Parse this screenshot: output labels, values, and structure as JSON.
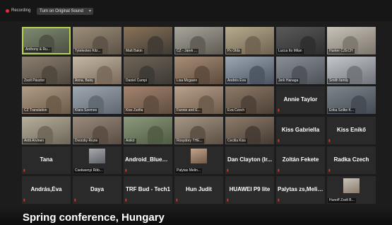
{
  "topbar": {
    "recording_label": "Recording",
    "sound_button_label": "Turn on Original Sound"
  },
  "caption": "Spring conference, Hungary",
  "tiles": [
    {
      "name": "Anthony & Ru...",
      "active": true,
      "video": true,
      "c1": "#7d8a70",
      "c2": "#4b4f43"
    },
    {
      "name": "Tyteleoteo Kilz...",
      "video": true,
      "c1": "#9c8e7a",
      "c2": "#5b5145"
    },
    {
      "name": "Matt Bakin",
      "video": true,
      "c1": "#8a7359",
      "c2": "#3e3a34"
    },
    {
      "name": "CZ - Jarek ...",
      "video": true,
      "c1": "#a7a69d",
      "c2": "#5f5a52"
    },
    {
      "name": "Px Olda",
      "video": true,
      "c1": "#b7ab8e",
      "c2": "#6e6251"
    },
    {
      "name": "Lucca Ito Milan",
      "video": true,
      "c1": "#5a5a5a",
      "c2": "#2e2e2e"
    },
    {
      "name": "Hunter CZECH",
      "video": true,
      "c1": "#c7c3bb",
      "c2": "#7d756b"
    },
    {
      "name": "Zsolt Pásztor",
      "video": true,
      "c1": "#8b7f70",
      "c2": "#4d463c"
    },
    {
      "name": "Anna, Baloj",
      "video": true,
      "c1": "#c3b8a4",
      "c2": "#78685a"
    },
    {
      "name": "Daniel Campi",
      "video": true,
      "c1": "#6f6658",
      "c2": "#3c3834"
    },
    {
      "name": "Lisa Mcgavin",
      "video": true,
      "c1": "#a88f78",
      "c2": "#5c4a3c"
    },
    {
      "name": "Andrés Eva",
      "video": true,
      "c1": "#9da6b2",
      "c2": "#4b5361"
    },
    {
      "name": "Jerk Hanaga",
      "video": true,
      "c1": "#8a8f96",
      "c2": "#4d5057"
    },
    {
      "name": "Smith family",
      "video": true,
      "c1": "#c4c7cc",
      "c2": "#6f7278"
    },
    {
      "name": "CZ Translation",
      "video": true,
      "c1": "#b19d87",
      "c2": "#6a5a48"
    },
    {
      "name": "Klara Szemes",
      "video": true,
      "c1": "#9fa7b0",
      "c2": "#5e6670"
    },
    {
      "name": "Kiss Zsófia",
      "video": true,
      "c1": "#a58470",
      "c2": "#5e4c3e"
    },
    {
      "name": "Fannie and E...",
      "video": true,
      "c1": "#b9a28d",
      "c2": "#6c5a4a"
    },
    {
      "name": "Eva Czech",
      "video": true,
      "c1": "#8e7a68",
      "c2": "#4c4036"
    },
    {
      "name": "Annie Taylor",
      "video": false
    },
    {
      "name": "Erika Szilke K...",
      "video": true,
      "c1": "#7e858d",
      "c2": "#444a52"
    },
    {
      "name": "Antti Arvinen",
      "video": true,
      "c1": "#b8b09e",
      "c2": "#6d6556"
    },
    {
      "name": "Dvorzky Rozie",
      "video": true,
      "c1": "#9a8b7c",
      "c2": "#584c42"
    },
    {
      "name": "Anikó",
      "video": true,
      "c1": "#8d9a7c",
      "c2": "#4f5a42"
    },
    {
      "name": "Rosydory THE...",
      "video": true,
      "c1": "#a69886",
      "c2": "#5b4f43"
    },
    {
      "name": "Cecilia Kiss",
      "video": true,
      "c1": "#8f7d6c",
      "c2": "#443a32"
    },
    {
      "name": "Kiss Gabriella",
      "video": false
    },
    {
      "name": "Kiss Enikő",
      "video": false
    },
    {
      "name": "Tana",
      "video": false
    },
    {
      "name": "Csekwenyi Rób...",
      "video": false,
      "thumb": true,
      "c1": "#a7a9ad",
      "c2": "#5e6167"
    },
    {
      "name": "Android_Bluedr...",
      "video": false
    },
    {
      "name": "Palytas Melin...",
      "video": false,
      "thumb": true,
      "c1": "#c2a48c",
      "c2": "#6f5a4a"
    },
    {
      "name": "Dan Clayton (Ir...",
      "video": false
    },
    {
      "name": "Zoltán Fekete",
      "video": false
    },
    {
      "name": "Radka Czech",
      "video": false
    },
    {
      "name": "András,Éva",
      "video": false
    },
    {
      "name": "Daya",
      "video": false
    },
    {
      "name": "TRF Bud - Tech1",
      "video": false
    },
    {
      "name": "Hun Judit",
      "video": false
    },
    {
      "name": "HUAWEI P9 lite",
      "video": false
    },
    {
      "name": "Palytas zs,Melin...",
      "video": false
    },
    {
      "name": "Hunoff Zsolt B...",
      "video": false,
      "thumb": true,
      "c1": "#c9c3bb",
      "c2": "#8a7a6a"
    }
  ]
}
